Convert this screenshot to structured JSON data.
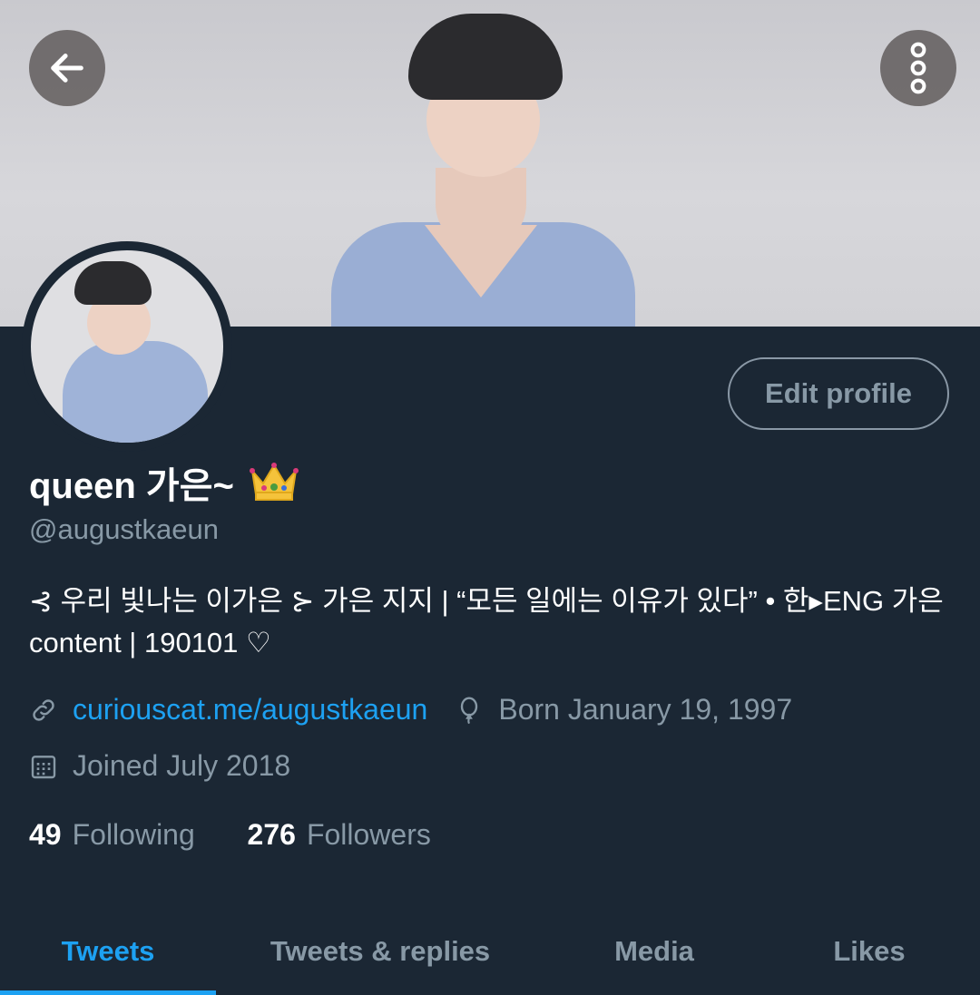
{
  "profile": {
    "display_name": "queen 가은~",
    "handle": "@augustkaeun",
    "bio": "⊰ 우리 빛나는 이가은 ⊱ 가은 지지 | “모든 일에는 이유가 있다” • 한▸ENG 가은 content | 190101 ♡",
    "website": "curiouscat.me/augustkaeun",
    "born": "Born January 19, 1997",
    "joined": "Joined July 2018",
    "following_count": "49",
    "following_label": "Following",
    "followers_count": "276",
    "followers_label": "Followers"
  },
  "actions": {
    "edit_profile": "Edit profile"
  },
  "tabs": [
    {
      "label": "Tweets",
      "active": true
    },
    {
      "label": "Tweets & replies",
      "active": false
    },
    {
      "label": "Media",
      "active": false
    },
    {
      "label": "Likes",
      "active": false
    }
  ],
  "icons": {
    "back": "arrow-left-icon",
    "more": "more-vertical-icon",
    "crown": "crown-emoji-icon",
    "link": "link-icon",
    "birthday": "balloon-icon",
    "joined": "calendar-icon"
  },
  "colors": {
    "background": "#1b2734",
    "accent": "#1da1f2",
    "secondary_text": "#8899a6"
  }
}
